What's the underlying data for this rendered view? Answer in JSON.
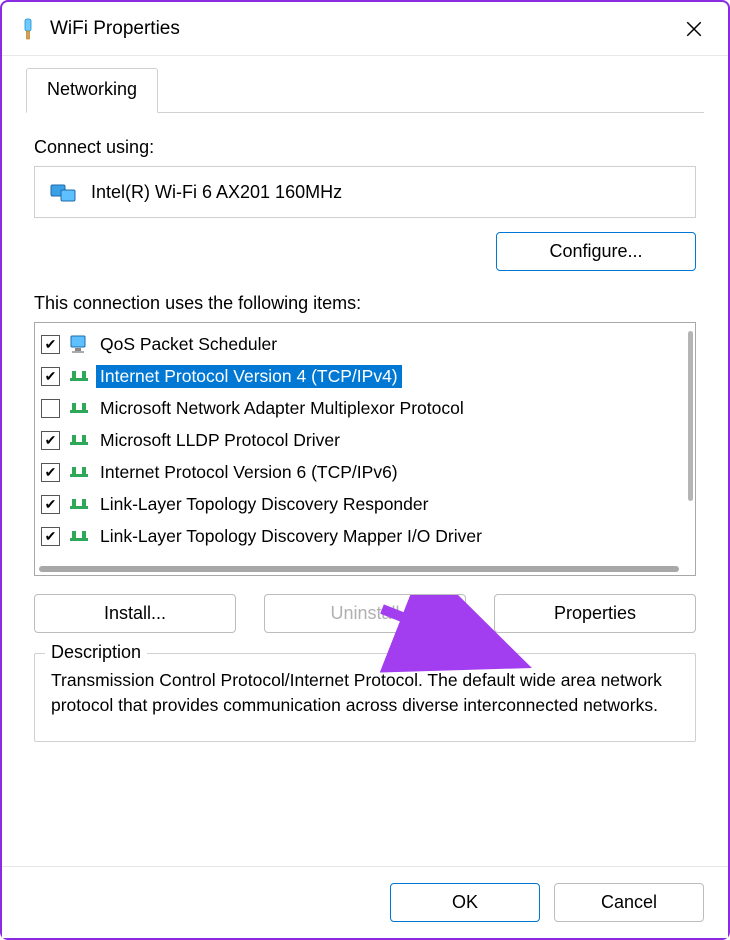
{
  "window": {
    "title": "WiFi Properties"
  },
  "tabs": {
    "networking": "Networking"
  },
  "connect_using_label": "Connect using:",
  "adapter_name": "Intel(R) Wi-Fi 6 AX201 160MHz",
  "configure_button": "Configure...",
  "items_label": "This connection uses the following items:",
  "items": [
    {
      "checked": true,
      "label": "QoS Packet Scheduler",
      "icon": "protocol-monitor",
      "selected": false
    },
    {
      "checked": true,
      "label": "Internet Protocol Version 4 (TCP/IPv4)",
      "icon": "protocol-net",
      "selected": true
    },
    {
      "checked": false,
      "label": "Microsoft Network Adapter Multiplexor Protocol",
      "icon": "protocol-net",
      "selected": false
    },
    {
      "checked": true,
      "label": "Microsoft LLDP Protocol Driver",
      "icon": "protocol-net",
      "selected": false
    },
    {
      "checked": true,
      "label": "Internet Protocol Version 6 (TCP/IPv6)",
      "icon": "protocol-net",
      "selected": false
    },
    {
      "checked": true,
      "label": "Link-Layer Topology Discovery Responder",
      "icon": "protocol-net",
      "selected": false
    },
    {
      "checked": true,
      "label": "Link-Layer Topology Discovery Mapper I/O Driver",
      "icon": "protocol-net",
      "selected": false
    }
  ],
  "buttons": {
    "install": "Install...",
    "uninstall": "Uninstall",
    "properties": "Properties",
    "ok": "OK",
    "cancel": "Cancel"
  },
  "description": {
    "legend": "Description",
    "text": "Transmission Control Protocol/Internet Protocol. The default wide area network protocol that provides communication across diverse interconnected networks."
  },
  "annotation": {
    "arrow_color": "#a23ef0"
  }
}
